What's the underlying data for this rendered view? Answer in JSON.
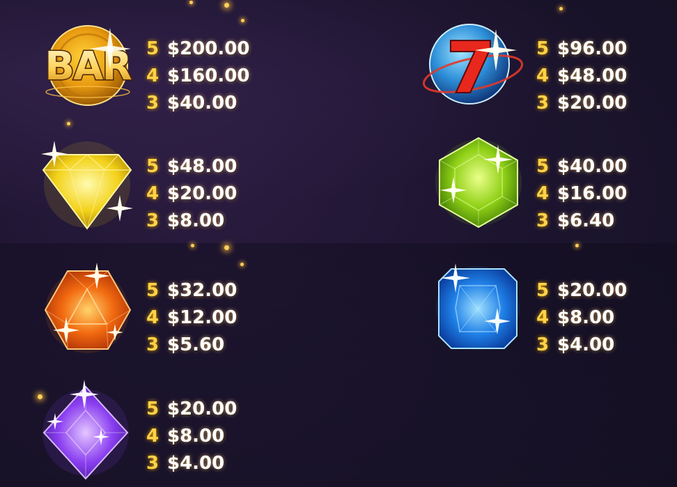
{
  "paytable": {
    "symbols": [
      {
        "symbol": "bar",
        "icon": "bar-coin-icon",
        "label": "BAR",
        "pays": [
          {
            "count": "5",
            "amount": "$200.00"
          },
          {
            "count": "4",
            "amount": "$160.00"
          },
          {
            "count": "3",
            "amount": "$40.00"
          }
        ]
      },
      {
        "symbol": "seven",
        "icon": "lucky-seven-icon",
        "label": "7",
        "pays": [
          {
            "count": "5",
            "amount": "$96.00"
          },
          {
            "count": "4",
            "amount": "$48.00"
          },
          {
            "count": "3",
            "amount": "$20.00"
          }
        ]
      },
      {
        "symbol": "yellow-gem",
        "icon": "yellow-diamond-gem-icon",
        "pays": [
          {
            "count": "5",
            "amount": "$48.00"
          },
          {
            "count": "4",
            "amount": "$20.00"
          },
          {
            "count": "3",
            "amount": "$8.00"
          }
        ]
      },
      {
        "symbol": "green-gem",
        "icon": "green-hexagon-gem-icon",
        "pays": [
          {
            "count": "5",
            "amount": "$40.00"
          },
          {
            "count": "4",
            "amount": "$16.00"
          },
          {
            "count": "3",
            "amount": "$6.40"
          }
        ]
      },
      {
        "symbol": "orange-gem",
        "icon": "orange-hexagon-gem-icon",
        "pays": [
          {
            "count": "5",
            "amount": "$32.00"
          },
          {
            "count": "4",
            "amount": "$12.00"
          },
          {
            "count": "3",
            "amount": "$5.60"
          }
        ]
      },
      {
        "symbol": "blue-gem",
        "icon": "blue-square-gem-icon",
        "pays": [
          {
            "count": "5",
            "amount": "$20.00"
          },
          {
            "count": "4",
            "amount": "$8.00"
          },
          {
            "count": "3",
            "amount": "$4.00"
          }
        ]
      },
      {
        "symbol": "purple-gem",
        "icon": "purple-diamond-gem-icon",
        "pays": [
          {
            "count": "5",
            "amount": "$20.00"
          },
          {
            "count": "4",
            "amount": "$8.00"
          },
          {
            "count": "3",
            "amount": "$4.00"
          }
        ]
      }
    ]
  },
  "colors": {
    "background": "#1d1530",
    "count_text": "#ffd24a",
    "amount_text": "#ffffff",
    "sparkle_dots": "#ffcf5a"
  }
}
